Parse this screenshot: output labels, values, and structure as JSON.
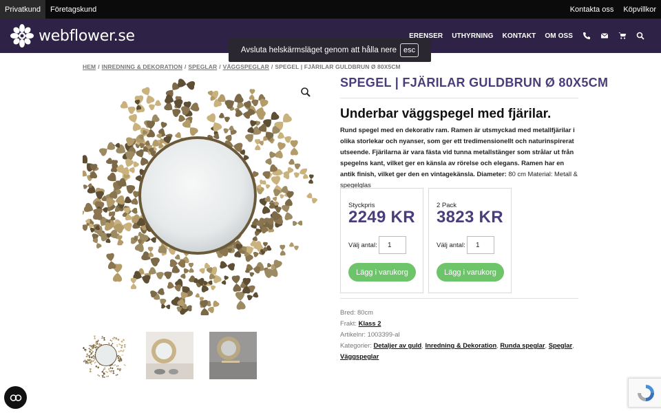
{
  "topbar": {
    "left": [
      "Privatkund",
      "Företagskund"
    ],
    "right": [
      "Kontakta oss",
      "Köpvillkor"
    ]
  },
  "brand": {
    "name": "webflower.se"
  },
  "nav": {
    "links": [
      "ERENSER",
      "UTHYRNING",
      "KONTAKT",
      "OM OSS"
    ],
    "icons": [
      "phone-icon",
      "envelope-icon",
      "cart-icon",
      "search-icon"
    ]
  },
  "fullscreen_notice": {
    "text": "Avsluta helskärmsläget genom att hålla nere",
    "key": "esc"
  },
  "breadcrumb": {
    "items": [
      "HEM",
      "INREDNING & DEKORATION",
      "SPEGLAR",
      "VÄGGSPEGLAR"
    ],
    "current": "SPEGEL | FJÄRILAR GULDBRUN Ø 80X5CM"
  },
  "product": {
    "title": "SPEGEL | FJÄRILAR GULDBRUN Ø 80X5CM",
    "subtitle": "Underbar väggspegel med fjärilar.",
    "description": "Rund spegel med en dekorativ ram. Ramen är utsmyckad med metallfjärilar i olika storlekar och nyanser, som ger ett tredimensionellt och naturinspirerat utseende. Fjärilarna är vara fästa vid tunna metallstänger som strålar ut från spegelns kant, vilket ger en känsla av rörelse och elegans. Ramen har en antik finish, vilket ger den en vintagekänsla.",
    "diameter_label": "Diameter:",
    "diameter_value": "80 cm Material: Metall & spegelglas"
  },
  "pricing": [
    {
      "label": "Styckpris",
      "price": "2249 KR",
      "qty_label": "Välj antal:",
      "qty": "1",
      "button": "Lägg i varukorg"
    },
    {
      "label": "2 Pack",
      "price": "3823 KR",
      "qty_label": "Välj antal:",
      "qty": "1",
      "button": "Lägg i varukorg"
    }
  ],
  "meta": {
    "width_label": "Bred:",
    "width_value": "80cm",
    "shipping_label": "Frakt:",
    "shipping_value": "Klass 2",
    "sku_label": "Artikelnr:",
    "sku_value": "1003399-al",
    "categories_label": "Kategorier:",
    "categories": [
      "Detaljer av guld",
      "Inredning & Dekoration",
      "Runda speglar",
      "Speglar",
      "Väggspeglar"
    ]
  },
  "colors": {
    "nav_bg": "#2e2346",
    "accent": "#4b3c7a",
    "cart_green": "#6ec46b",
    "topbar_bg": "#0b0b0b"
  }
}
